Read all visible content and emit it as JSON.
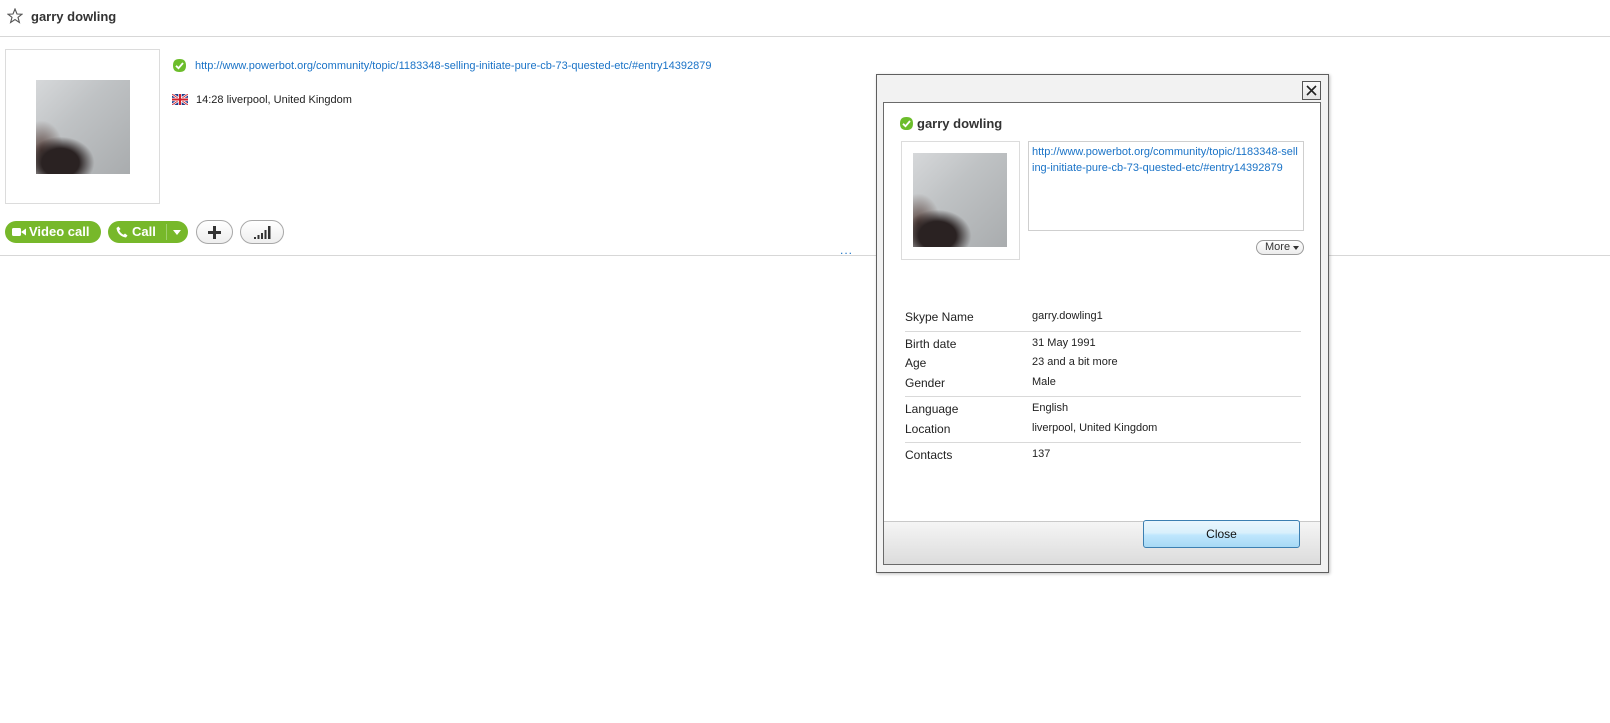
{
  "header": {
    "title": "garry dowling"
  },
  "profile": {
    "mood_url": "http://www.powerbot.org/community/topic/1183348-selling-initiate-pure-cb-73-quested-etc/#entry14392879",
    "local_time_location": "14:28 liverpool, United Kingdom"
  },
  "actions": {
    "video_call_label": "Video call",
    "call_label": "Call"
  },
  "overflow_dots": "...",
  "dialog": {
    "name": "garry dowling",
    "mood_url": "http://www.powerbot.org/community/topic/1183348-selling-initiate-pure-cb-73-quested-etc/#entry14392879",
    "more_label": "More",
    "fields": {
      "skype_name": {
        "label": "Skype Name",
        "value": "garry.dowling1"
      },
      "birth_date": {
        "label": "Birth date",
        "value": "31 May 1991"
      },
      "age": {
        "label": "Age",
        "value": "23 and a bit more"
      },
      "gender": {
        "label": "Gender",
        "value": "Male"
      },
      "language": {
        "label": "Language",
        "value": "English"
      },
      "location": {
        "label": "Location",
        "value": "liverpool, United Kingdom"
      },
      "contacts": {
        "label": "Contacts",
        "value": "137"
      }
    },
    "close_label": "Close"
  },
  "colors": {
    "accent_green": "#77b82a",
    "link_blue": "#1a73c7"
  }
}
